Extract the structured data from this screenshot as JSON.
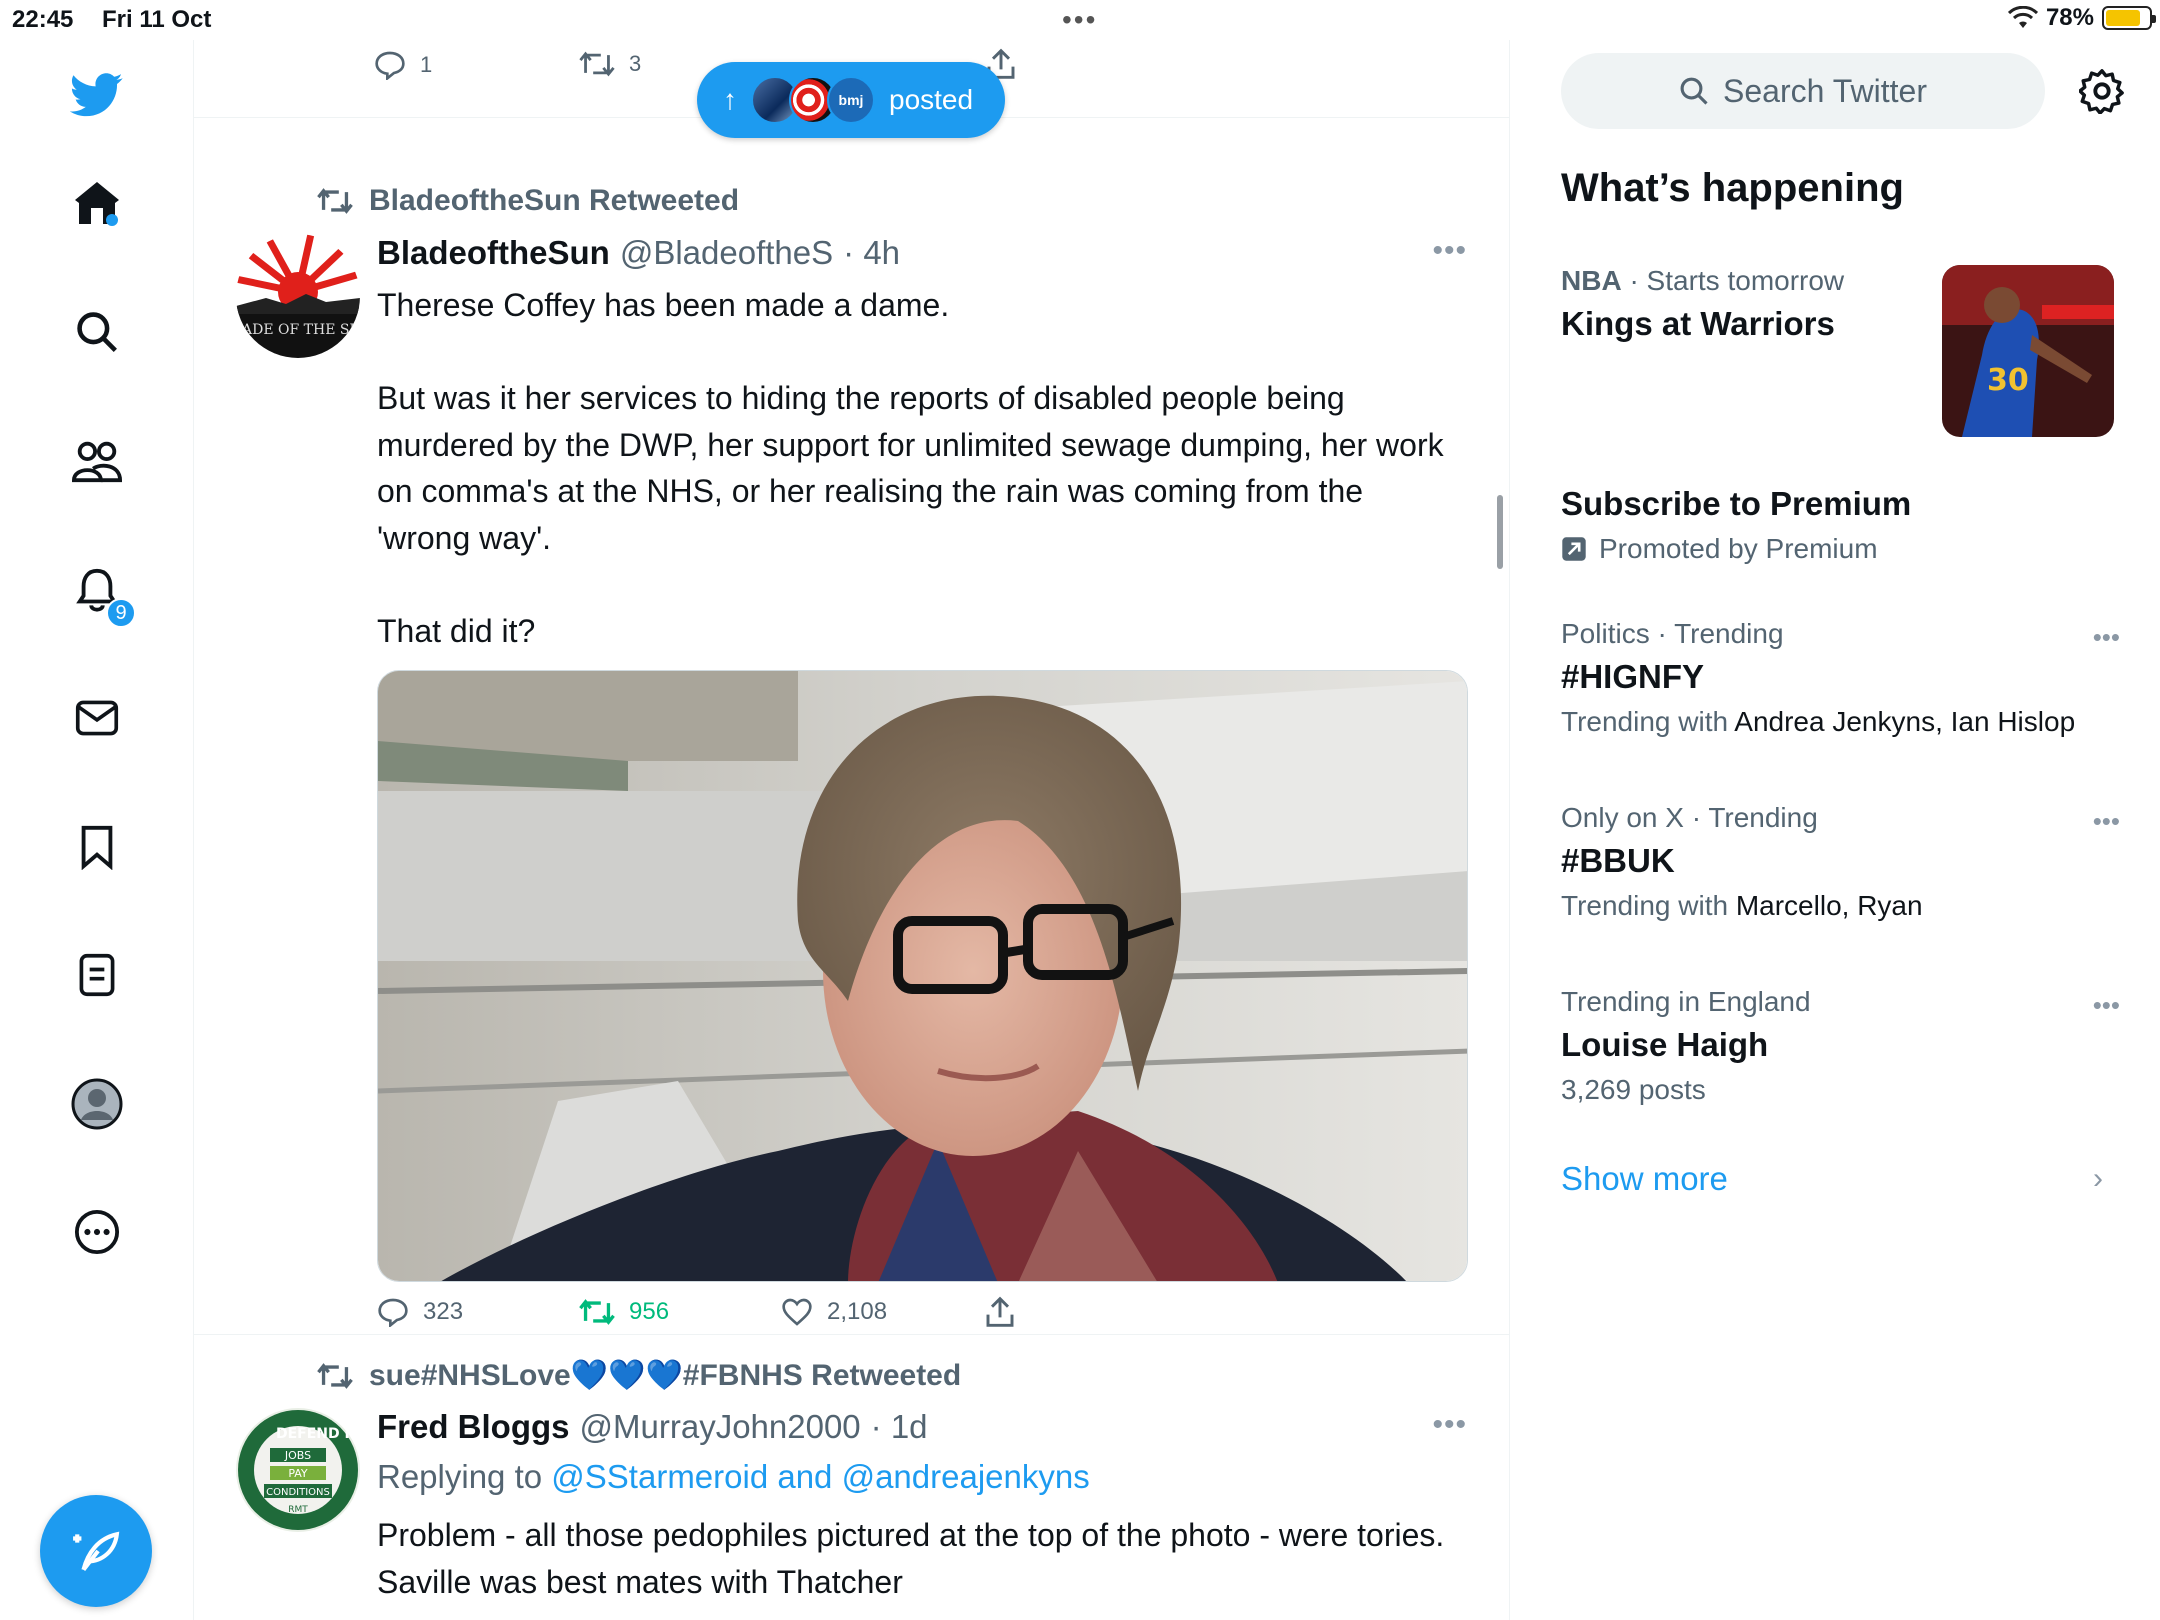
{
  "status_bar": {
    "time": "22:45",
    "date": "Fri 11 Oct",
    "battery": "78%"
  },
  "nav": {
    "items": [
      "twitter-logo",
      "home",
      "explore",
      "communities",
      "notifications",
      "messages",
      "bookmarks",
      "lists",
      "profile",
      "more"
    ],
    "notifications_badge": "9"
  },
  "top_tweet": {
    "reply_count": "1",
    "retweet_count": "3"
  },
  "new_posts_pill": {
    "label": "posted",
    "avatar_label": "bmj"
  },
  "tweet1": {
    "retweeted_by": "BladeoftheSun Retweeted",
    "name": "BladeoftheSun",
    "handle": "@BladeoftheS",
    "time": "· 4h",
    "avatar_text": "BLADE OF THE SUN",
    "text_p1": "Therese Coffey has been made a dame.",
    "text_p2": "But was it her services to hiding the reports of disabled people being murdered by the DWP, her support for unlimited sewage dumping, her work on comma's at the NHS, or her realising the rain was coming from the 'wrong way'.",
    "text_p3": "That did it?",
    "replies": "323",
    "retweets": "956",
    "likes": "2,108"
  },
  "tweet2": {
    "retweeted_by": "sue#NHSLove💙💙💙#FBNHS Retweeted",
    "name": "Fred Bloggs",
    "handle": "@MurrayJohn2000",
    "time": "· 1d",
    "avatar_text": "DEFEND Rail",
    "avatar_lines": [
      "JOBS",
      "PAY",
      "CONDITIONS",
      "RMT"
    ],
    "replying_prefix": "Replying to",
    "replying_to": "@SStarmeroid and @andreajenkyns",
    "text": "Problem - all those pedophiles pictured at the top of the photo - were tories. Saville was best mates with Thatcher"
  },
  "sidebar": {
    "search_placeholder": "Search Twitter",
    "whats_happening": "What’s happening",
    "trends": [
      {
        "context_bold": "NBA",
        "context": " · Starts tomorrow",
        "title": "Kings at Warriors"
      },
      {
        "title": "Subscribe to Premium",
        "promoted": "Promoted by Premium"
      },
      {
        "context": "Politics · Trending",
        "title": "#HIGNFY",
        "sub_prefix": "Trending with ",
        "sub": "Andrea Jenkyns, Ian Hislop"
      },
      {
        "context": "Only on X · Trending",
        "title": "#BBUK",
        "sub_prefix": "Trending with ",
        "sub": "Marcello, Ryan"
      },
      {
        "context": "Trending in England",
        "title": "Louise Haigh",
        "sub_prefix": "3,269 posts"
      }
    ],
    "show_more": "Show more"
  },
  "colors": {
    "accent": "#1d9bf0",
    "retweet_green": "#00ba7c",
    "text": "#0f1419",
    "muted": "#536471"
  }
}
